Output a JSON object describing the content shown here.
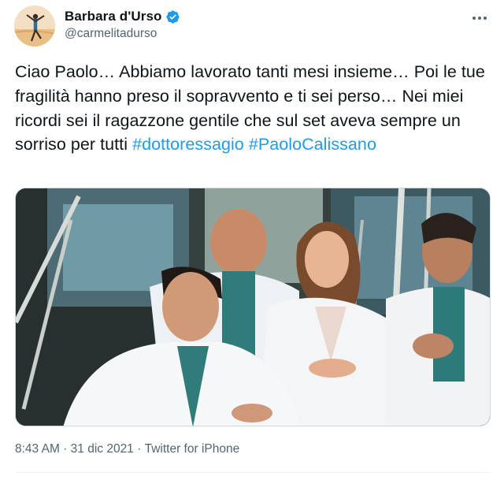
{
  "author": {
    "display_name": "Barbara d'Urso",
    "handle": "@carmelitadurso",
    "verified": true
  },
  "tweet": {
    "text_plain": "Ciao Paolo… Abbiamo lavorato tanti mesi insieme… Poi le tue fragilità hanno preso il sopravvento e ti sei perso… Nei miei ricordi sei il ragazzone gentile che sul set aveva sempre un sorriso per tutti ",
    "hashtags": [
      "#dottoressagio",
      "#PaoloCalissano"
    ]
  },
  "meta": {
    "time": "8:43 AM",
    "separator": " · ",
    "date": "31 dic 2021",
    "source": "Twitter for iPhone"
  },
  "icons": {
    "verified": "verified-badge-icon",
    "more": "more-options-icon"
  },
  "colors": {
    "link": "#1d9bf0",
    "secondary_text": "#536471",
    "primary_text": "#0f1419"
  }
}
